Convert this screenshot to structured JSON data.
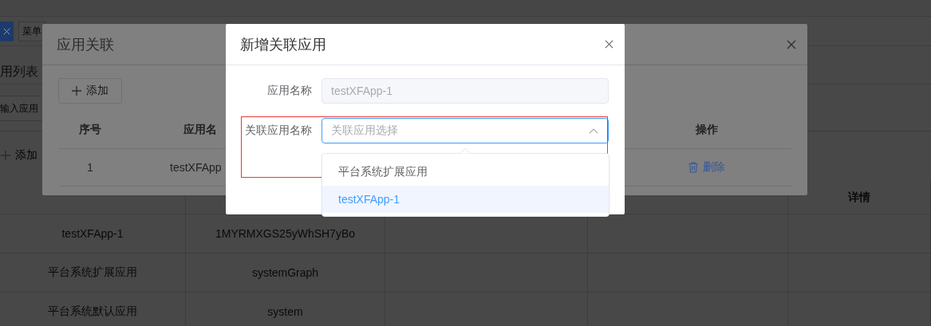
{
  "background_page": {
    "tabs": [
      {
        "kind": "closable",
        "selected": true
      },
      {
        "kind": "label",
        "label": "菜单",
        "selected": false
      }
    ],
    "section_title": "用列表",
    "search": {
      "placeholder": "输入应用"
    },
    "add_button": "添加",
    "detail_column": "详情",
    "rows": [
      [
        "testXFApp-1",
        "1MYRMXGS25yWhSH7yBo"
      ],
      [
        "平台系统扩展应用",
        "systemGraph"
      ],
      [
        "平台系统默认应用",
        "system"
      ]
    ]
  },
  "association_dialog": {
    "title": "应用关联",
    "add_button": "添加",
    "columns": [
      "序号",
      "应用名",
      "操作"
    ],
    "rows": [
      {
        "index": "1",
        "name": "testXFApp",
        "action": "删除"
      }
    ]
  },
  "new_dialog": {
    "title": "新增关联应用",
    "fields": [
      {
        "kind": "input",
        "label": "应用名称",
        "value": "testXFApp-1",
        "disabled": true
      },
      {
        "kind": "select",
        "label": "关联应用名称",
        "placeholder": "关联应用选择",
        "expanded": true,
        "highlighted": true
      }
    ],
    "options": [
      {
        "label": "平台系统扩展应用",
        "selected": false
      },
      {
        "label": "testXFApp-1",
        "selected": true
      }
    ]
  }
}
